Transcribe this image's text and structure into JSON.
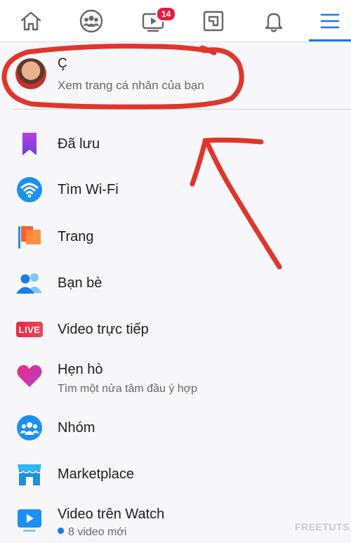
{
  "nav": {
    "items": [
      {
        "name": "home-icon"
      },
      {
        "name": "groups-icon"
      },
      {
        "name": "watch-icon",
        "badge": "14"
      },
      {
        "name": "gaming-icon"
      },
      {
        "name": "bell-icon"
      },
      {
        "name": "menu-icon"
      }
    ],
    "active_color": "#1877f2",
    "badge_color": "#e41e3f"
  },
  "profile": {
    "name": "Ç",
    "subtitle": "Xem trang cá nhân của bạn"
  },
  "menu": {
    "items": [
      {
        "label": "Đã lưu",
        "icon": "bookmark-icon"
      },
      {
        "label": "Tìm Wi-Fi",
        "icon": "wifi-icon"
      },
      {
        "label": "Trang",
        "icon": "pages-flag-icon"
      },
      {
        "label": "Bạn bè",
        "icon": "friends-icon"
      },
      {
        "label": "Video trực tiếp",
        "icon": "live-icon",
        "icon_text": "LIVE"
      },
      {
        "label": "Hẹn hò",
        "sub": "Tìm một nửa tâm đầu ý hợp",
        "icon": "dating-heart-icon"
      },
      {
        "label": "Nhóm",
        "icon": "groups-icon"
      },
      {
        "label": "Marketplace",
        "icon": "marketplace-icon"
      },
      {
        "label": "Video trên Watch",
        "sub": "8 video mới",
        "icon": "watch-video-icon"
      }
    ]
  },
  "annotation": {
    "color": "#e0352b"
  },
  "watermark": "FREETUTS"
}
